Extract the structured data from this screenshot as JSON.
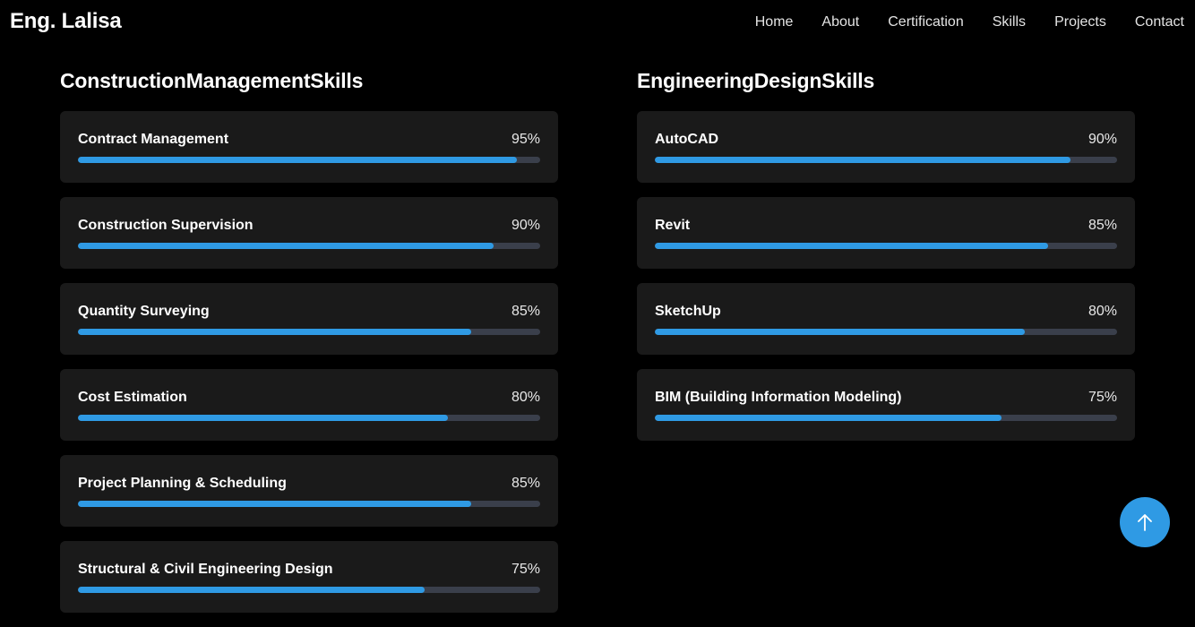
{
  "brand": "Eng. Lalisa",
  "nav": [
    "Home",
    "About",
    "Certification",
    "Skills",
    "Projects",
    "Contact"
  ],
  "sections": [
    {
      "title": "ConstructionManagementSkills",
      "skills": [
        {
          "name": "Contract Management",
          "percent": "95%",
          "value": 95
        },
        {
          "name": "Construction Supervision",
          "percent": "90%",
          "value": 90
        },
        {
          "name": "Quantity Surveying",
          "percent": "85%",
          "value": 85
        },
        {
          "name": "Cost Estimation",
          "percent": "80%",
          "value": 80
        },
        {
          "name": "Project Planning & Scheduling",
          "percent": "85%",
          "value": 85
        },
        {
          "name": "Structural & Civil Engineering Design",
          "percent": "75%",
          "value": 75
        }
      ]
    },
    {
      "title": "EngineeringDesignSkills",
      "skills": [
        {
          "name": "AutoCAD",
          "percent": "90%",
          "value": 90
        },
        {
          "name": "Revit",
          "percent": "85%",
          "value": 85
        },
        {
          "name": "SketchUp",
          "percent": "80%",
          "value": 80
        },
        {
          "name": "BIM (Building Information Modeling)",
          "percent": "75%",
          "value": 75
        }
      ]
    }
  ],
  "scroll_top_icon": "arrow-up-icon",
  "colors": {
    "accent": "#2f9ae4",
    "card": "#1a1a1a",
    "track": "#3a3f4b",
    "background": "#000000"
  }
}
